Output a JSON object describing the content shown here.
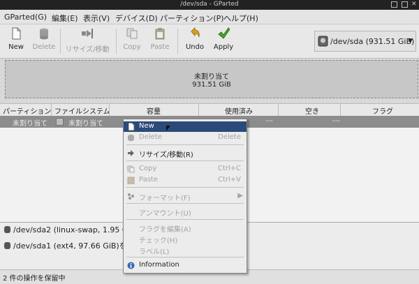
{
  "window": {
    "title": "/dev/sda - GParted"
  },
  "menubar": [
    {
      "label": "GParted(G)"
    },
    {
      "label": "編集(E)"
    },
    {
      "label": "表示(V)"
    },
    {
      "label": "デバイス(D)"
    },
    {
      "label": "パーティション(P)"
    },
    {
      "label": "ヘルプ(H)"
    }
  ],
  "toolbar": {
    "new_label": "New",
    "delete_label": "Delete",
    "resize_label": "リサイズ/移動",
    "copy_label": "Copy",
    "paste_label": "Paste",
    "undo_label": "Undo",
    "apply_label": "Apply"
  },
  "device": {
    "label": "/dev/sda  (931.51 GiB)",
    "icon": "disk-icon"
  },
  "disk_bar": {
    "label": "未割り当て",
    "size": "931.51 GiB"
  },
  "table": {
    "headers": [
      "パーティション",
      "ファイルシステム",
      "容量",
      "使用済み",
      "空き",
      "フラグ"
    ],
    "row": {
      "partition": "未割り当て",
      "filesystem": "未割り当て",
      "used": "---",
      "unused": "---"
    }
  },
  "context_menu": [
    {
      "label": "New",
      "shortcut": "",
      "icon": "new-icon",
      "state": "highlighted"
    },
    {
      "label": "Delete",
      "shortcut": "Delete",
      "icon": "delete-icon",
      "state": "disabled"
    },
    {
      "label": "リサイズ/移動(R)",
      "shortcut": "",
      "icon": "resize-icon",
      "state": "normal"
    },
    {
      "label": "Copy",
      "shortcut": "Ctrl+C",
      "icon": "copy-icon",
      "state": "disabled"
    },
    {
      "label": "Paste",
      "shortcut": "Ctrl+V",
      "icon": "paste-icon",
      "state": "disabled"
    },
    {
      "label": "フォーマット(F)",
      "shortcut": "",
      "icon": "format-icon",
      "state": "disabled"
    },
    {
      "label": "アンマウント(U)",
      "shortcut": "",
      "icon": "",
      "state": "disabled"
    },
    {
      "label": "フラグを編集(A)",
      "shortcut": "",
      "icon": "",
      "state": "disabled"
    },
    {
      "label": "チェック(H)",
      "shortcut": "",
      "icon": "",
      "state": "disabled"
    },
    {
      "label": "ラベル(L)",
      "shortcut": "",
      "icon": "",
      "state": "disabled"
    },
    {
      "label": "Information",
      "shortcut": "",
      "icon": "info-icon",
      "state": "normal"
    }
  ],
  "operations": [
    "/dev/sda2 (linux-swap, 1.95 GiB)",
    "/dev/sda1 (ext4, 97.66 GiB)を/"
  ],
  "status": "2 件の操作を保留中",
  "colors": {
    "highlight": "#2b4a7a",
    "selected_row": "#8c8c8c",
    "apply_check": "#4aa02c",
    "undo_arrow": "#d9a020"
  }
}
